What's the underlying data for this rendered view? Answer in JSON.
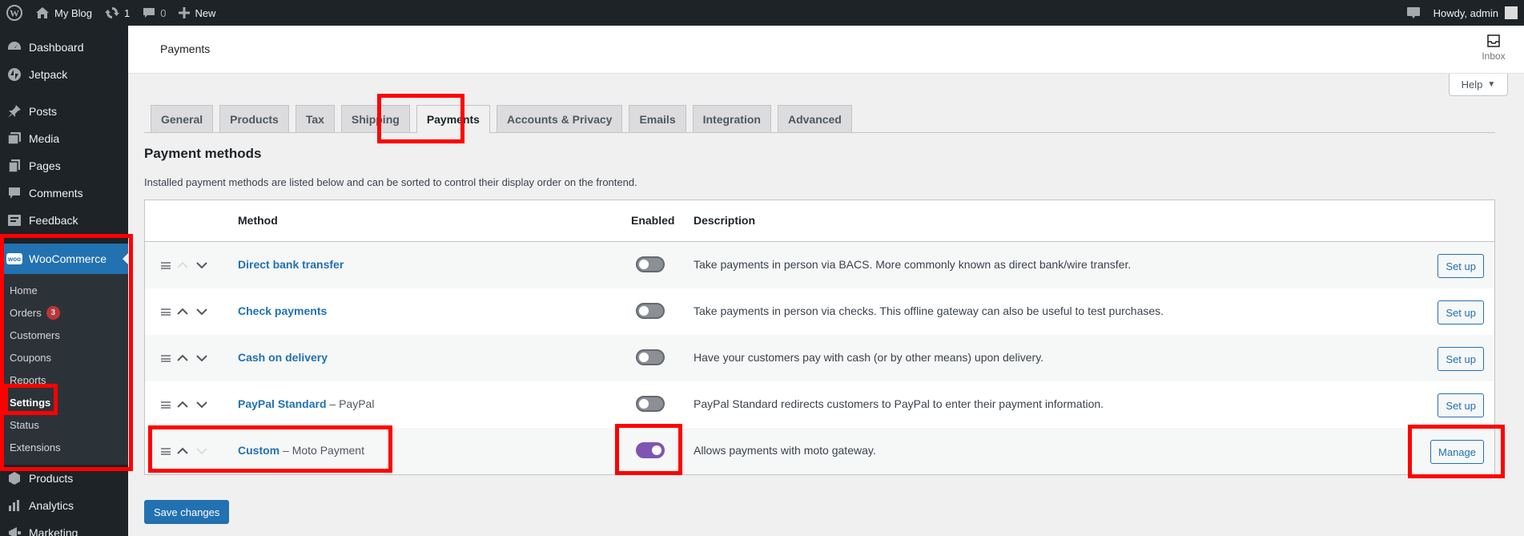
{
  "adminbar": {
    "site_name": "My Blog",
    "updates_count": "1",
    "comments_count": "0",
    "new_label": "New",
    "greeting": "Howdy, admin"
  },
  "sidebar": {
    "top_items": [
      {
        "label": "Dashboard",
        "icon": "dashboard-icon"
      },
      {
        "label": "Jetpack",
        "icon": "jetpack-icon"
      }
    ],
    "mid_items": [
      {
        "label": "Posts",
        "icon": "pin-icon"
      },
      {
        "label": "Media",
        "icon": "media-icon"
      },
      {
        "label": "Pages",
        "icon": "pages-icon"
      },
      {
        "label": "Comments",
        "icon": "comment-icon"
      },
      {
        "label": "Feedback",
        "icon": "feedback-icon"
      }
    ],
    "woocommerce": {
      "label": "WooCommerce",
      "logo_text": "woo",
      "submenu": [
        {
          "label": "Home"
        },
        {
          "label": "Orders",
          "badge": "3"
        },
        {
          "label": "Customers"
        },
        {
          "label": "Coupons"
        },
        {
          "label": "Reports"
        },
        {
          "label": "Settings",
          "current": true
        },
        {
          "label": "Status"
        },
        {
          "label": "Extensions"
        }
      ]
    },
    "bottom_items": [
      {
        "label": "Products",
        "icon": "products-icon"
      },
      {
        "label": "Analytics",
        "icon": "analytics-icon"
      },
      {
        "label": "Marketing",
        "icon": "marketing-icon"
      }
    ]
  },
  "header": {
    "title": "Payments",
    "inbox_label": "Inbox",
    "help_label": "Help"
  },
  "tabs": [
    {
      "label": "General"
    },
    {
      "label": "Products"
    },
    {
      "label": "Tax"
    },
    {
      "label": "Shipping"
    },
    {
      "label": "Payments",
      "active": true
    },
    {
      "label": "Accounts & Privacy"
    },
    {
      "label": "Emails"
    },
    {
      "label": "Integration"
    },
    {
      "label": "Advanced"
    }
  ],
  "section": {
    "title": "Payment methods",
    "description": "Installed payment methods are listed below and can be sorted to control their display order on the frontend."
  },
  "table": {
    "columns": {
      "method": "Method",
      "enabled": "Enabled",
      "description": "Description"
    },
    "rows": [
      {
        "name": "Direct bank transfer",
        "suffix": "",
        "enabled": false,
        "description": "Take payments in person via BACS. More commonly known as direct bank/wire transfer.",
        "action": "Set up"
      },
      {
        "name": "Check payments",
        "suffix": "",
        "enabled": false,
        "description": "Take payments in person via checks. This offline gateway can also be useful to test purchases.",
        "action": "Set up"
      },
      {
        "name": "Cash on delivery",
        "suffix": "",
        "enabled": false,
        "description": "Have your customers pay with cash (or by other means) upon delivery.",
        "action": "Set up"
      },
      {
        "name": "PayPal Standard",
        "suffix": " – PayPal",
        "enabled": false,
        "description": "PayPal Standard redirects customers to PayPal to enter their payment information.",
        "action": "Set up"
      },
      {
        "name": "Custom",
        "suffix": " – Moto Payment",
        "enabled": true,
        "description": "Allows payments with moto gateway.",
        "action": "Manage"
      }
    ]
  },
  "save_label": "Save changes",
  "colors": {
    "admin_dark": "#1d2327",
    "wp_blue": "#2271b1",
    "woo_purple": "#7f54b3",
    "highlight_red": "#ff0000"
  }
}
